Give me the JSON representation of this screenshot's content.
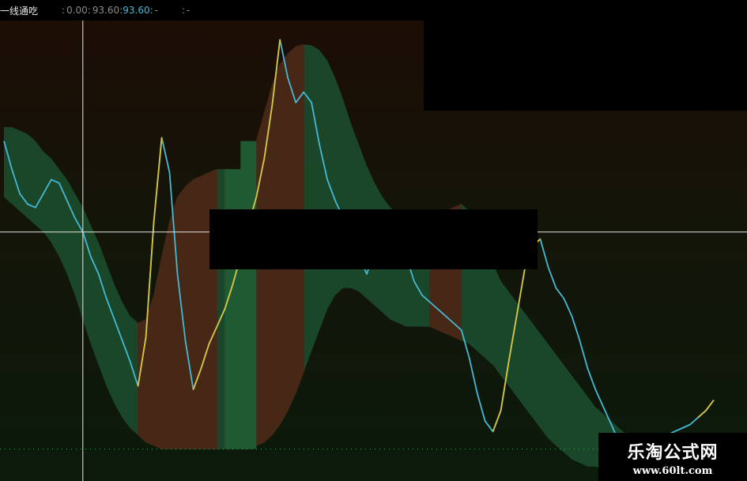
{
  "header": {
    "indicator_name": "一线通吃",
    "label_a": ":",
    "value_a": "0.00",
    "separator": ":",
    "value_b": "93.60",
    "label_c": ":",
    "value_c": "93.60",
    "label_d": ":",
    "value_d": "-",
    "label_e": ":",
    "value_e": "-"
  },
  "watermark": {
    "line1": "乐淘公式网",
    "line2": "www.60lt.com"
  },
  "colors": {
    "background_top": "#1c0d05",
    "background_bottom": "#0b1a0b",
    "band_fill": "#1b4a2b",
    "brown_fill": "#472716",
    "green_column": "#1f5a33",
    "rising_line": "#d8c23a",
    "falling_line": "#45b9d6",
    "crosshair": "#e6e6e6",
    "dotted_baseline": "#35a35a"
  },
  "chart_data": {
    "type": "line",
    "x": [
      0,
      10,
      20,
      30,
      40,
      50,
      60,
      70,
      80,
      90,
      100,
      110,
      120,
      130,
      140,
      150,
      160,
      170,
      180,
      190,
      200,
      210,
      220,
      230,
      240,
      250,
      260,
      270,
      280,
      290,
      300,
      310,
      320,
      330,
      340,
      350,
      360,
      370,
      380,
      390,
      400,
      410,
      420,
      430,
      440,
      450,
      460,
      470,
      480,
      490,
      500,
      510,
      520,
      530,
      540,
      550,
      560,
      570,
      580,
      590,
      600,
      610,
      620,
      630,
      640,
      650,
      660,
      670,
      680,
      690,
      700,
      710,
      720,
      730,
      740,
      750,
      760,
      770,
      780,
      790,
      800,
      810,
      820,
      830,
      840,
      850,
      860,
      870,
      880,
      890,
      900
    ],
    "series": [
      {
        "name": "",
        "color": "#45b9d6",
        "values": [
          66,
          58,
          51,
          48,
          47,
          51,
          55,
          54,
          49,
          44,
          40,
          33,
          28,
          21,
          15,
          9,
          3,
          -4,
          10,
          43,
          67,
          57,
          28,
          9,
          -5,
          1,
          8,
          13,
          18,
          25,
          33,
          42,
          50,
          61,
          76,
          95,
          84,
          77,
          80,
          77,
          65,
          55,
          49,
          44,
          39,
          33,
          28,
          35,
          44,
          45,
          38,
          33,
          26,
          22,
          20,
          18,
          16,
          14,
          12,
          4,
          -6,
          -14,
          -17,
          -11,
          3,
          16,
          29,
          36,
          38,
          30,
          24,
          21,
          16,
          9,
          1,
          -5,
          -10,
          -15,
          -20,
          -24,
          -26,
          -25,
          -23,
          -20,
          -18,
          -17,
          -16,
          -15,
          -13,
          -11,
          -8
        ]
      },
      {
        "name": "",
        "color": "#d8c23a",
        "values": [
          null,
          null,
          null,
          null,
          null,
          null,
          null,
          null,
          null,
          null,
          null,
          null,
          null,
          null,
          null,
          null,
          null,
          -4,
          10,
          43,
          67,
          null,
          null,
          null,
          -5,
          1,
          8,
          13,
          18,
          25,
          33,
          42,
          50,
          61,
          76,
          95,
          null,
          null,
          null,
          null,
          null,
          null,
          null,
          null,
          null,
          null,
          null,
          35,
          44,
          45,
          null,
          null,
          null,
          null,
          null,
          null,
          null,
          null,
          null,
          null,
          null,
          null,
          -17,
          -11,
          3,
          16,
          29,
          36,
          38,
          null,
          null,
          null,
          null,
          null,
          null,
          null,
          null,
          null,
          null,
          null,
          null,
          null,
          null,
          null,
          null,
          null,
          null,
          null,
          -13,
          -11,
          -8
        ]
      },
      {
        "name": "",
        "values": [
          70,
          70,
          69,
          68,
          66,
          63,
          61,
          58,
          55,
          51,
          47,
          42,
          37,
          31,
          25,
          20,
          16,
          14,
          15,
          22,
          33,
          43,
          50,
          53,
          55,
          56,
          57,
          58,
          58,
          57,
          57,
          60,
          66,
          74,
          82,
          88,
          91,
          93,
          93.6,
          93.4,
          92,
          89,
          84,
          78,
          71,
          65,
          59,
          54,
          50,
          47,
          45,
          44,
          44,
          44,
          44,
          45,
          46,
          47,
          48,
          46,
          42,
          37,
          31,
          26,
          23,
          20,
          17,
          14,
          11,
          8,
          5,
          2,
          -1,
          -4,
          -7,
          -10,
          -12,
          -14,
          -16,
          -18,
          -19,
          -20,
          -21,
          -22,
          -23,
          -24,
          -25,
          -25,
          -26,
          -26,
          -26
        ]
      },
      {
        "name": "",
        "values": [
          50,
          48,
          46,
          44,
          42,
          40,
          37,
          33,
          28,
          22,
          15,
          8,
          2,
          -4,
          -9,
          -13,
          -16,
          -18,
          -20,
          -21,
          -22,
          -22,
          -22,
          -22,
          -22,
          -22,
          -22,
          -22,
          -22,
          -22,
          -22,
          -22,
          -21,
          -20,
          -18,
          -15,
          -11,
          -6,
          0,
          6,
          12,
          18,
          22,
          24,
          24,
          23,
          21,
          19,
          17,
          15,
          14,
          13,
          13,
          13,
          13,
          12,
          11,
          10,
          9,
          8,
          6,
          4,
          2,
          -1,
          -4,
          -7,
          -10,
          -13,
          -16,
          -19,
          -21,
          -23,
          -25,
          -26,
          -27,
          -27,
          -28,
          -28,
          -28,
          -28,
          -28,
          -28,
          -28,
          -28,
          -28,
          -28,
          -28,
          -28,
          -28,
          -28,
          -28
        ]
      }
    ],
    "ylim": [
      -30,
      100
    ]
  }
}
